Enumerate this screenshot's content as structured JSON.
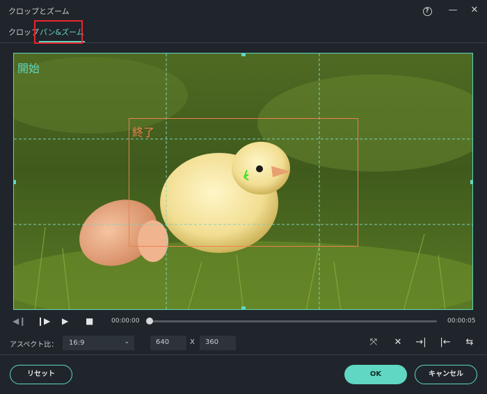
{
  "window": {
    "title": "クロップとズーム"
  },
  "tabs": [
    {
      "label": "クロップ"
    },
    {
      "label": "パン&ズーム"
    }
  ],
  "preview": {
    "start_label": "開始",
    "end_label": "終了"
  },
  "playback": {
    "current_time": "00:00:00",
    "total_time": "00:00:05",
    "progress": 0
  },
  "aspect": {
    "label": "アスペクト比：",
    "selected": "16:9",
    "width": "640",
    "separator": "X",
    "height": "360"
  },
  "buttons": {
    "reset": "リセット",
    "ok": "OK",
    "cancel": "キャンセル"
  },
  "colors": {
    "accent": "#5fd7c2",
    "end_box": "#f08050",
    "highlight": "#e8272d",
    "background": "#20252b"
  }
}
